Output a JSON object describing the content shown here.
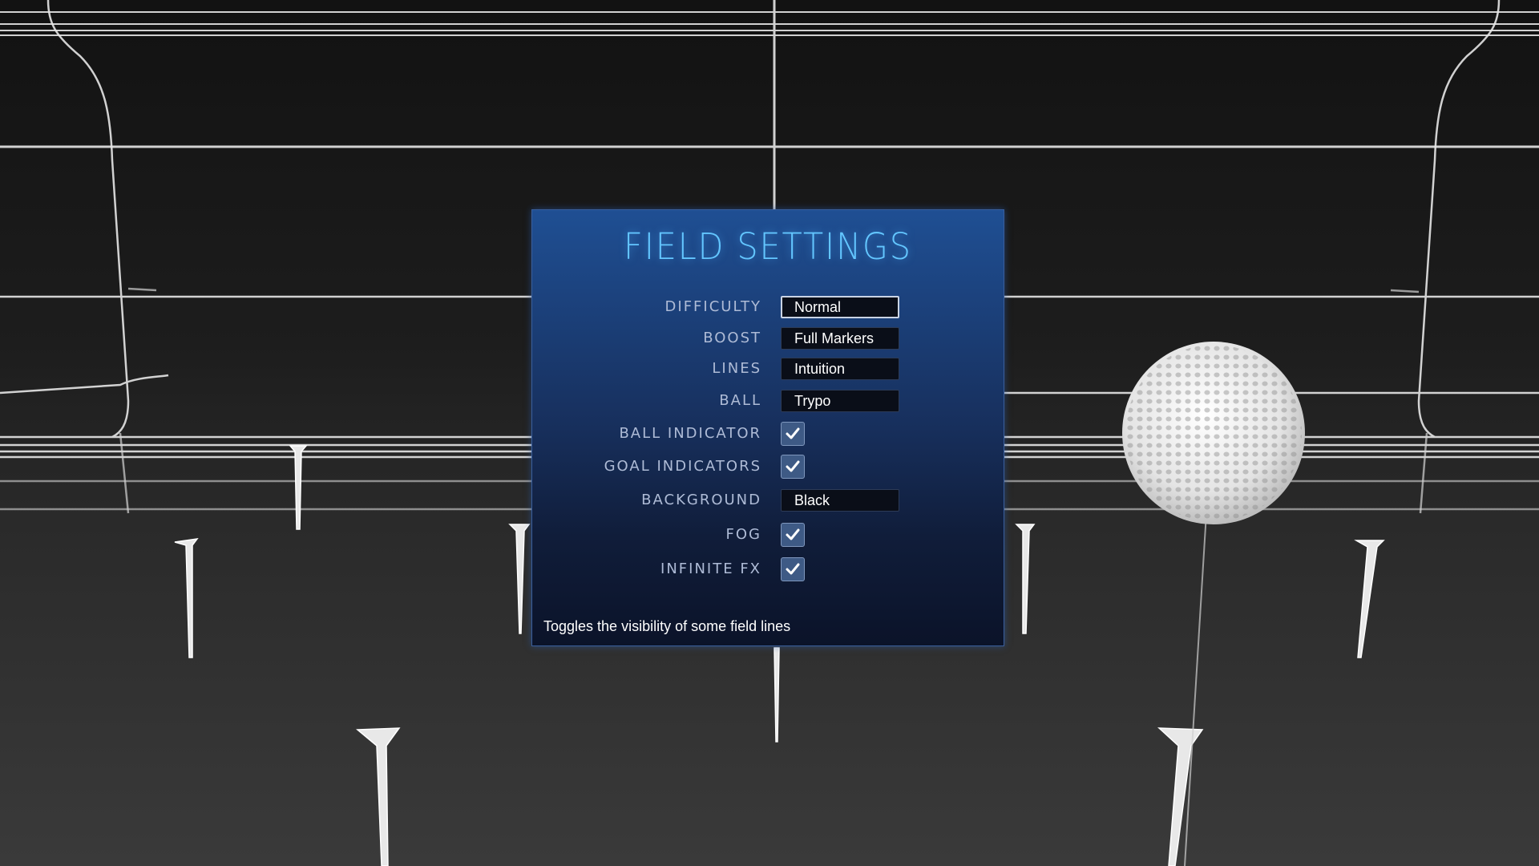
{
  "panel": {
    "title": "FIELD SETTINGS",
    "description": "Toggles the visibility of some field lines"
  },
  "settings": {
    "difficulty": {
      "label": "DIFFICULTY",
      "value": "Normal"
    },
    "boost": {
      "label": "BOOST",
      "value": "Full Markers"
    },
    "lines": {
      "label": "LINES",
      "value": "Intuition"
    },
    "ball": {
      "label": "BALL",
      "value": "Trypo"
    },
    "ball_indicator": {
      "label": "BALL INDICATOR",
      "checked": true
    },
    "goal_indicators": {
      "label": "GOAL INDICATORS",
      "checked": true
    },
    "background": {
      "label": "BACKGROUND",
      "value": "Black"
    },
    "fog": {
      "label": "FOG",
      "checked": true
    },
    "infinite_fx": {
      "label": "INFINITE FX",
      "checked": true
    }
  },
  "colors": {
    "title": "#63c6ff",
    "panel_top": "#1f4f93",
    "panel_bottom": "#0b1329",
    "checkbox_fill": "#3e5a85",
    "arena_lines": "#e8e8e8"
  },
  "icons": {
    "checkmark": "check-icon"
  }
}
